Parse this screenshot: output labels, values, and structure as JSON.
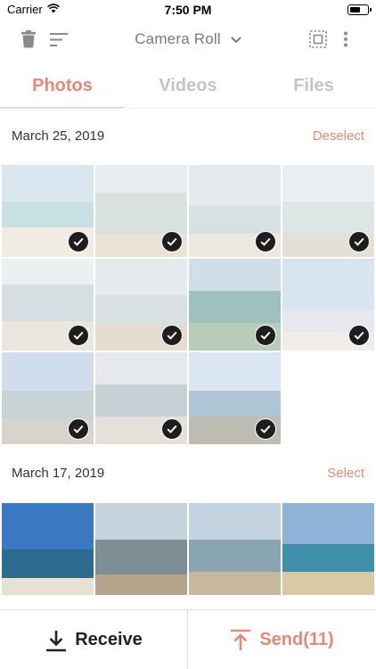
{
  "status": {
    "carrier": "Carrier",
    "time": "7:50 PM"
  },
  "toolbar": {
    "album_title": "Camera Roll",
    "icons": [
      "trash-icon",
      "sort-icon",
      "chevron-down-icon",
      "select-all-icon",
      "more-vertical-icon"
    ]
  },
  "tabs": [
    {
      "label": "Photos",
      "active": true
    },
    {
      "label": "Videos",
      "active": false
    },
    {
      "label": "Files",
      "active": false
    }
  ],
  "sections": [
    {
      "date": "March 25, 2019",
      "action": "Deselect",
      "photo_count": 11,
      "selected_count": 11
    },
    {
      "date": "March 17, 2019",
      "action": "Select",
      "photo_count": 4,
      "selected_count": 0
    }
  ],
  "bottom_bar": {
    "receive_label": "Receive",
    "send_label": "Send(11)"
  },
  "colors": {
    "accent": "#e8877a",
    "inactive_tab": "#c4c4c4",
    "check_badge": "#1e1e1e"
  }
}
